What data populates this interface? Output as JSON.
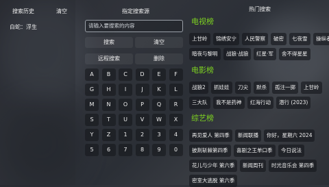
{
  "history": {
    "title": "搜索历史",
    "clear": "清空",
    "items": [
      "白蛇：浮生"
    ]
  },
  "search": {
    "title": "指定搜索源",
    "placeholder": "请输入要搜索的内容",
    "search_btn": "搜索",
    "clear_btn": "清空",
    "remote_btn": "远程搜索",
    "delete_btn": "删除"
  },
  "keyboard": {
    "rows": [
      [
        "A",
        "B",
        "C",
        "D",
        "E",
        "F"
      ],
      [
        "G",
        "H",
        "I",
        "J",
        "K",
        "L"
      ],
      [
        "M",
        "N",
        "O",
        "P",
        "Q",
        "R"
      ],
      [
        "S",
        "T",
        "U",
        "V",
        "W",
        "X"
      ],
      [
        "Y",
        "Z",
        "1",
        "2",
        "3",
        "4"
      ],
      [
        "5",
        "6",
        "7",
        "8",
        "9",
        "0"
      ]
    ]
  },
  "hot": {
    "title": "热门搜索",
    "sections": [
      {
        "title": "电视榜",
        "chips": [
          [
            "上甘岭",
            "锦绣安宁",
            "人民警察",
            "破密",
            "七夜雪",
            "操纵者"
          ],
          [
            "暗夜与黎明",
            "战狼·战狼",
            "红星·军",
            "舍不得星星"
          ]
        ]
      },
      {
        "title": "电影榜",
        "chips": [
          [
            "战狼2",
            "抓娃娃",
            "刀尖",
            "默杀",
            "孤注一掷",
            "上甘岭"
          ],
          [
            "三大队",
            "我不是药神",
            "红海行动",
            "潜行 (2023)"
          ]
        ]
      },
      {
        "title": "综艺榜",
        "chips": [
          [
            "再见爱人 第四季",
            "新闻联播",
            "你好，星期六 2024"
          ],
          [
            "披荆斩棘第四季",
            "喜剧之王单口季",
            "今日说法"
          ],
          [
            "花儿与少年 第六季",
            "新闻周刊",
            "时光音乐会 第四季"
          ],
          [
            "密室大逃脱 第六季"
          ]
        ]
      }
    ]
  }
}
